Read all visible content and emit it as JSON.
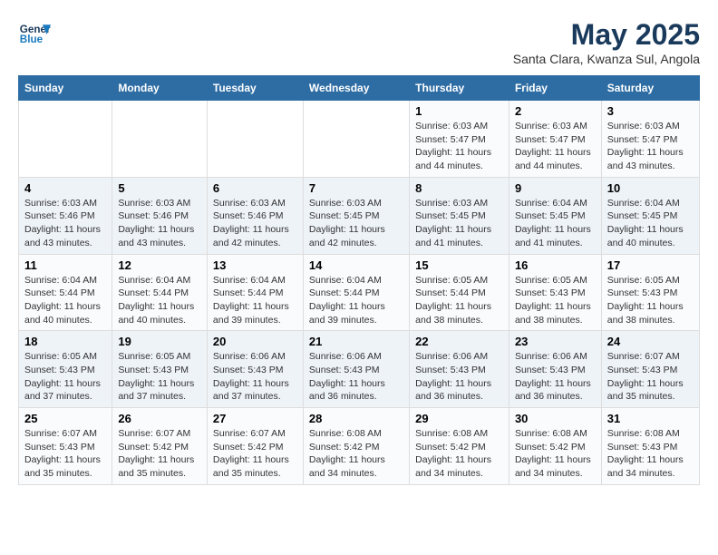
{
  "logo": {
    "line1": "General",
    "line2": "Blue"
  },
  "title": "May 2025",
  "subtitle": "Santa Clara, Kwanza Sul, Angola",
  "days_of_week": [
    "Sunday",
    "Monday",
    "Tuesday",
    "Wednesday",
    "Thursday",
    "Friday",
    "Saturday"
  ],
  "weeks": [
    {
      "cells": [
        {
          "day": "",
          "content": ""
        },
        {
          "day": "",
          "content": ""
        },
        {
          "day": "",
          "content": ""
        },
        {
          "day": "",
          "content": ""
        },
        {
          "day": "1",
          "sunrise": "6:03 AM",
          "sunset": "5:47 PM",
          "daylight": "11 hours and 44 minutes."
        },
        {
          "day": "2",
          "sunrise": "6:03 AM",
          "sunset": "5:47 PM",
          "daylight": "11 hours and 44 minutes."
        },
        {
          "day": "3",
          "sunrise": "6:03 AM",
          "sunset": "5:47 PM",
          "daylight": "11 hours and 43 minutes."
        }
      ]
    },
    {
      "cells": [
        {
          "day": "4",
          "sunrise": "6:03 AM",
          "sunset": "5:46 PM",
          "daylight": "11 hours and 43 minutes."
        },
        {
          "day": "5",
          "sunrise": "6:03 AM",
          "sunset": "5:46 PM",
          "daylight": "11 hours and 43 minutes."
        },
        {
          "day": "6",
          "sunrise": "6:03 AM",
          "sunset": "5:46 PM",
          "daylight": "11 hours and 42 minutes."
        },
        {
          "day": "7",
          "sunrise": "6:03 AM",
          "sunset": "5:45 PM",
          "daylight": "11 hours and 42 minutes."
        },
        {
          "day": "8",
          "sunrise": "6:03 AM",
          "sunset": "5:45 PM",
          "daylight": "11 hours and 41 minutes."
        },
        {
          "day": "9",
          "sunrise": "6:04 AM",
          "sunset": "5:45 PM",
          "daylight": "11 hours and 41 minutes."
        },
        {
          "day": "10",
          "sunrise": "6:04 AM",
          "sunset": "5:45 PM",
          "daylight": "11 hours and 40 minutes."
        }
      ]
    },
    {
      "cells": [
        {
          "day": "11",
          "sunrise": "6:04 AM",
          "sunset": "5:44 PM",
          "daylight": "11 hours and 40 minutes."
        },
        {
          "day": "12",
          "sunrise": "6:04 AM",
          "sunset": "5:44 PM",
          "daylight": "11 hours and 40 minutes."
        },
        {
          "day": "13",
          "sunrise": "6:04 AM",
          "sunset": "5:44 PM",
          "daylight": "11 hours and 39 minutes."
        },
        {
          "day": "14",
          "sunrise": "6:04 AM",
          "sunset": "5:44 PM",
          "daylight": "11 hours and 39 minutes."
        },
        {
          "day": "15",
          "sunrise": "6:05 AM",
          "sunset": "5:44 PM",
          "daylight": "11 hours and 38 minutes."
        },
        {
          "day": "16",
          "sunrise": "6:05 AM",
          "sunset": "5:43 PM",
          "daylight": "11 hours and 38 minutes."
        },
        {
          "day": "17",
          "sunrise": "6:05 AM",
          "sunset": "5:43 PM",
          "daylight": "11 hours and 38 minutes."
        }
      ]
    },
    {
      "cells": [
        {
          "day": "18",
          "sunrise": "6:05 AM",
          "sunset": "5:43 PM",
          "daylight": "11 hours and 37 minutes."
        },
        {
          "day": "19",
          "sunrise": "6:05 AM",
          "sunset": "5:43 PM",
          "daylight": "11 hours and 37 minutes."
        },
        {
          "day": "20",
          "sunrise": "6:06 AM",
          "sunset": "5:43 PM",
          "daylight": "11 hours and 37 minutes."
        },
        {
          "day": "21",
          "sunrise": "6:06 AM",
          "sunset": "5:43 PM",
          "daylight": "11 hours and 36 minutes."
        },
        {
          "day": "22",
          "sunrise": "6:06 AM",
          "sunset": "5:43 PM",
          "daylight": "11 hours and 36 minutes."
        },
        {
          "day": "23",
          "sunrise": "6:06 AM",
          "sunset": "5:43 PM",
          "daylight": "11 hours and 36 minutes."
        },
        {
          "day": "24",
          "sunrise": "6:07 AM",
          "sunset": "5:43 PM",
          "daylight": "11 hours and 35 minutes."
        }
      ]
    },
    {
      "cells": [
        {
          "day": "25",
          "sunrise": "6:07 AM",
          "sunset": "5:43 PM",
          "daylight": "11 hours and 35 minutes."
        },
        {
          "day": "26",
          "sunrise": "6:07 AM",
          "sunset": "5:42 PM",
          "daylight": "11 hours and 35 minutes."
        },
        {
          "day": "27",
          "sunrise": "6:07 AM",
          "sunset": "5:42 PM",
          "daylight": "11 hours and 35 minutes."
        },
        {
          "day": "28",
          "sunrise": "6:08 AM",
          "sunset": "5:42 PM",
          "daylight": "11 hours and 34 minutes."
        },
        {
          "day": "29",
          "sunrise": "6:08 AM",
          "sunset": "5:42 PM",
          "daylight": "11 hours and 34 minutes."
        },
        {
          "day": "30",
          "sunrise": "6:08 AM",
          "sunset": "5:42 PM",
          "daylight": "11 hours and 34 minutes."
        },
        {
          "day": "31",
          "sunrise": "6:08 AM",
          "sunset": "5:43 PM",
          "daylight": "11 hours and 34 minutes."
        }
      ]
    }
  ]
}
